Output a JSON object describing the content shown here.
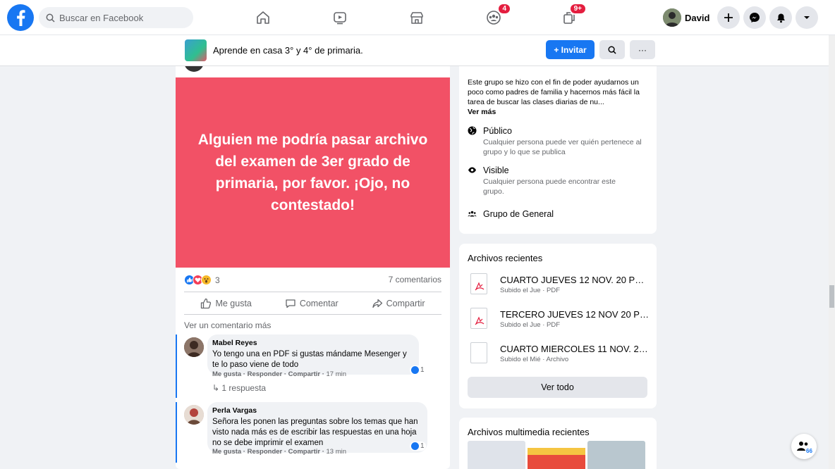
{
  "nav": {
    "search_placeholder": "Buscar en Facebook",
    "groups_badge": "4",
    "pages_badge": "9+",
    "user_name": "David"
  },
  "group": {
    "name": "Aprende en casa 3° y 4° de primaria.",
    "invite_label": "+ Invitar",
    "more_label": "···"
  },
  "post": {
    "banner_text": "Alguien me podría pasar archivo del examen de 3er grado de primaria, por favor. ¡Ojo, no contestado!",
    "reaction_count": "3",
    "comments_count": "7 comentarios",
    "like_label": "Me gusta",
    "comment_label": "Comentar",
    "share_label": "Compartir",
    "more_comments": "Ver un comentario más",
    "comments": [
      {
        "author": "Mabel Reyes",
        "text": "Yo tengo una en PDF si gustas mándame Mesenger y te lo paso viene de todo",
        "actions": "Me gusta · Responder · Compartir · ",
        "time": "17 min",
        "likes": "1",
        "replies": "1 respuesta"
      },
      {
        "author": "Perla Vargas",
        "text": "Señora les ponen las preguntas sobre los temas que han visto nada más es de escribir las respuestas en una hoja no se debe imprimir el examen",
        "actions": "Me gusta · Responder · Compartir · ",
        "time": "13 min",
        "likes": "1"
      }
    ]
  },
  "info": {
    "description": "Este grupo se hizo con el fin de poder ayudarnos un poco como padres de familia y hacernos más fácil la tarea de buscar las clases diarias de nu...",
    "see_more": "Ver más",
    "public_title": "Público",
    "public_desc": "Cualquier persona puede ver quién pertenece al grupo y lo que se publica",
    "visible_title": "Visible",
    "visible_desc": "Cualquier persona puede encontrar este grupo.",
    "group_type": "Grupo de General"
  },
  "files": {
    "title": "Archivos recientes",
    "items": [
      {
        "name": "CUARTO JUEVES 12 NOV. 20 PÁG...",
        "sub": "Subido el Jue · PDF"
      },
      {
        "name": "TERCERO JUEVES 12 NOV 20 PÁ...",
        "sub": "Subido el Jue · PDF"
      },
      {
        "name": "CUARTO MIERCOLES 11 NOV. 20 ...",
        "sub": "Subido el Mié · Archivo"
      }
    ],
    "see_all": "Ver todo"
  },
  "media": {
    "title": "Archivos multimedia recientes"
  },
  "fab_count": "66",
  "colors": {
    "brand": "#1877f2",
    "banner": "#f25166",
    "badge": "#e41e3f"
  }
}
